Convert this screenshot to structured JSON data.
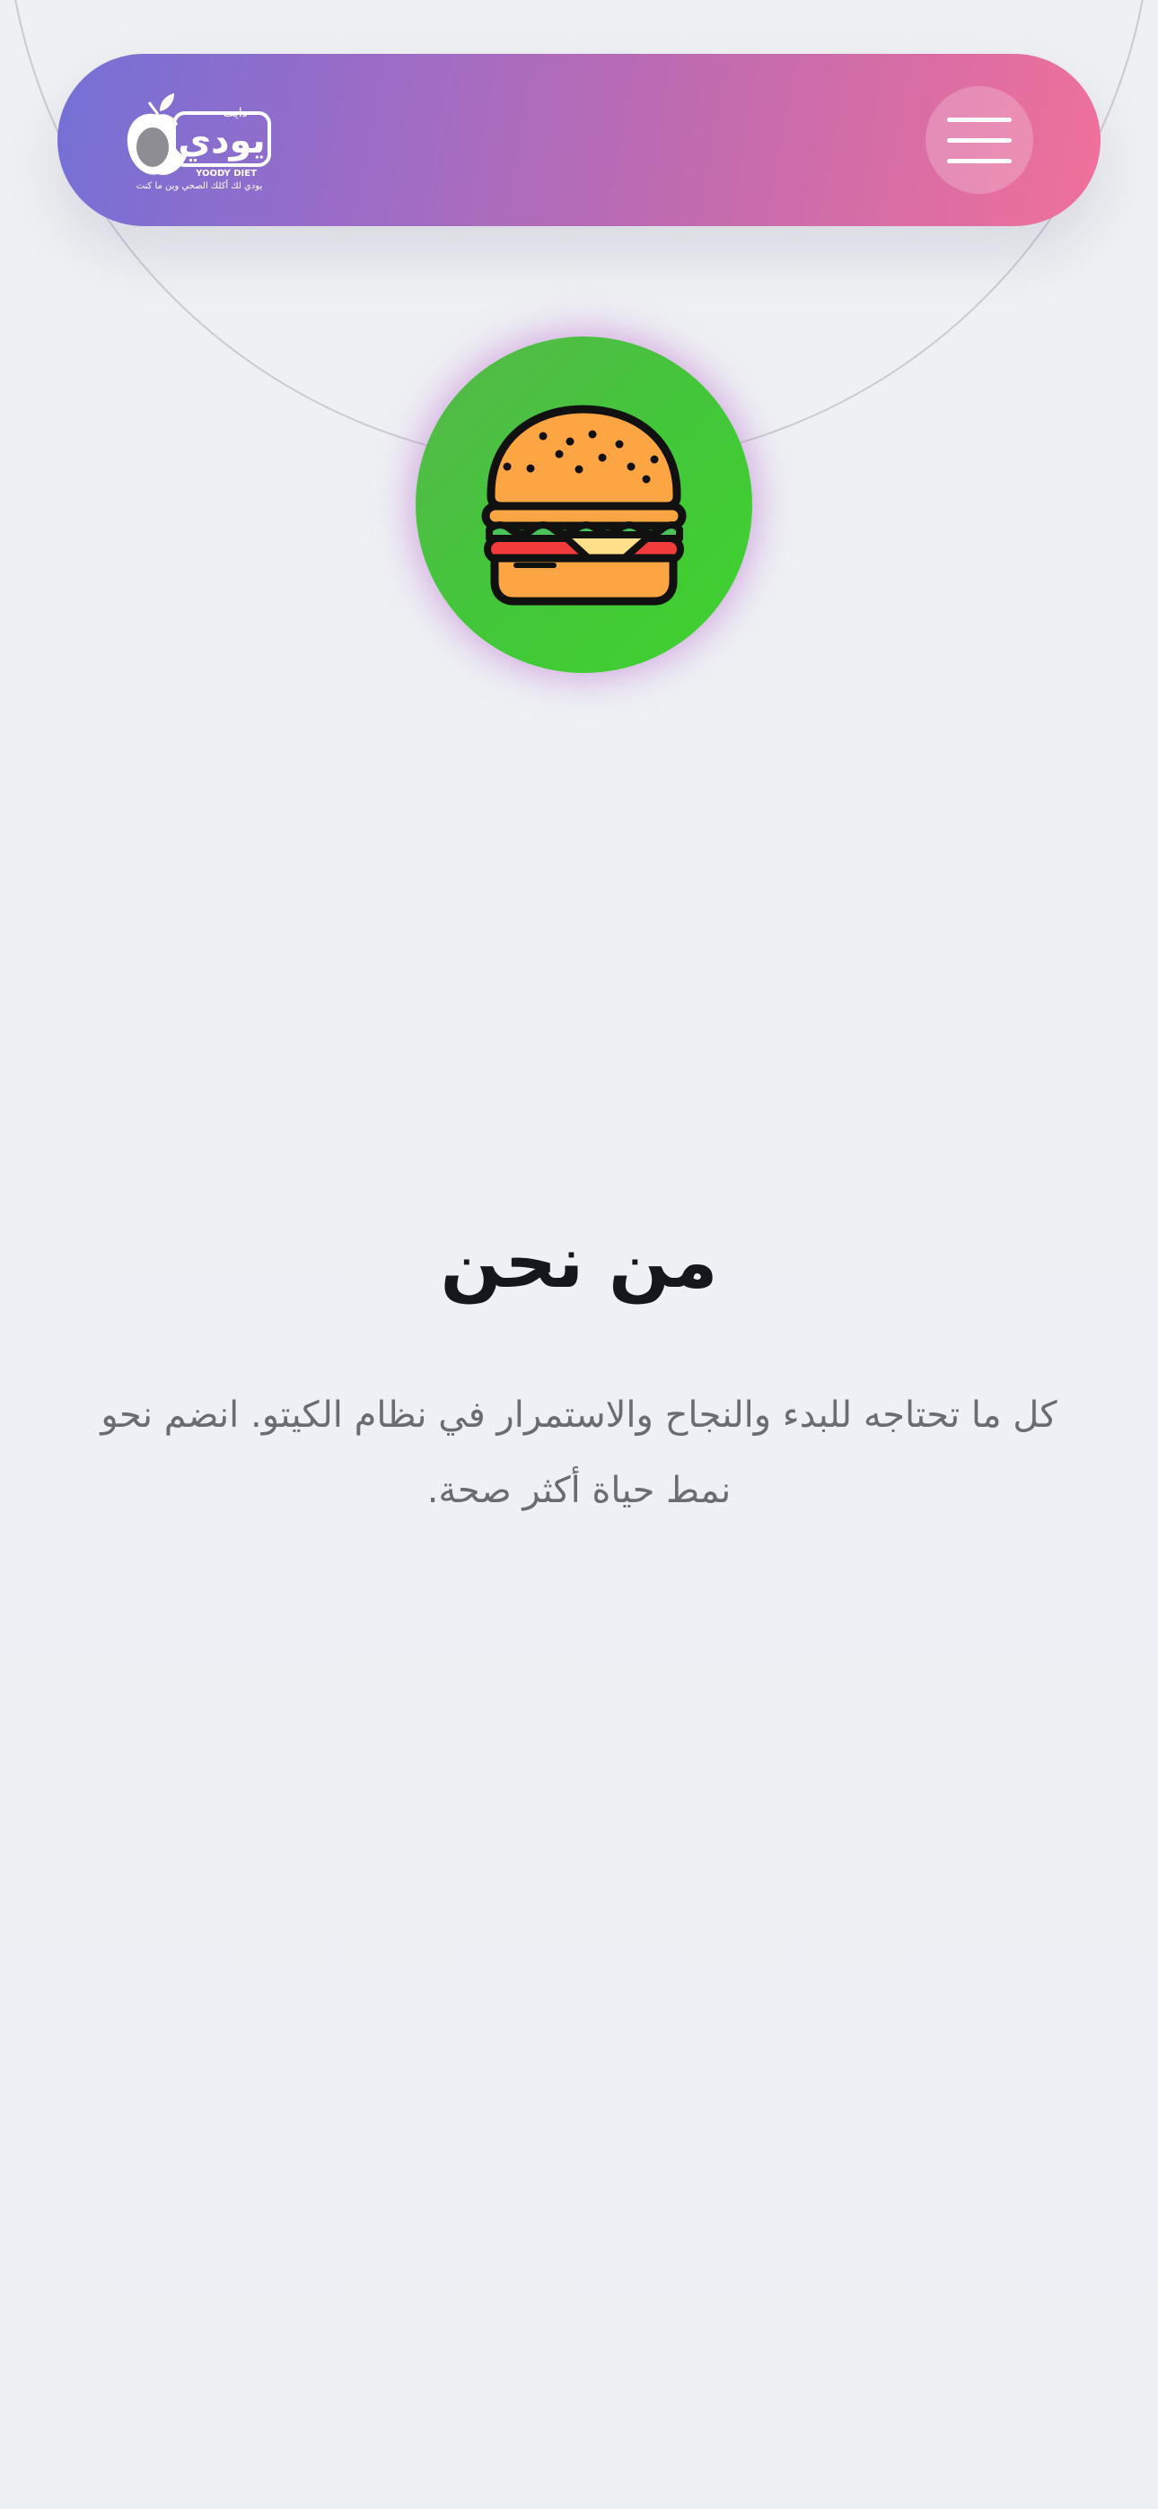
{
  "header": {
    "logo": {
      "brand_arabic": "يودي",
      "sub_arabic": "دايت",
      "brand_latin": "YOODY DIET",
      "tagline": "يودي لك أكلك الصحي وين ما كنت"
    },
    "menu_icon": "hamburger-menu-icon",
    "gradient": [
      "#7470d6",
      "#f0709a"
    ]
  },
  "feature": {
    "icon": "burger-icon",
    "circle_color": "#43c63a",
    "glow_color": "#c06bd2"
  },
  "about": {
    "title": "من نحن",
    "description": "كل ما تحتاجه للبدء والنجاح والاستمرار في نظام الكيتو. انضم نحو نمط حياة أكثر صحة."
  }
}
